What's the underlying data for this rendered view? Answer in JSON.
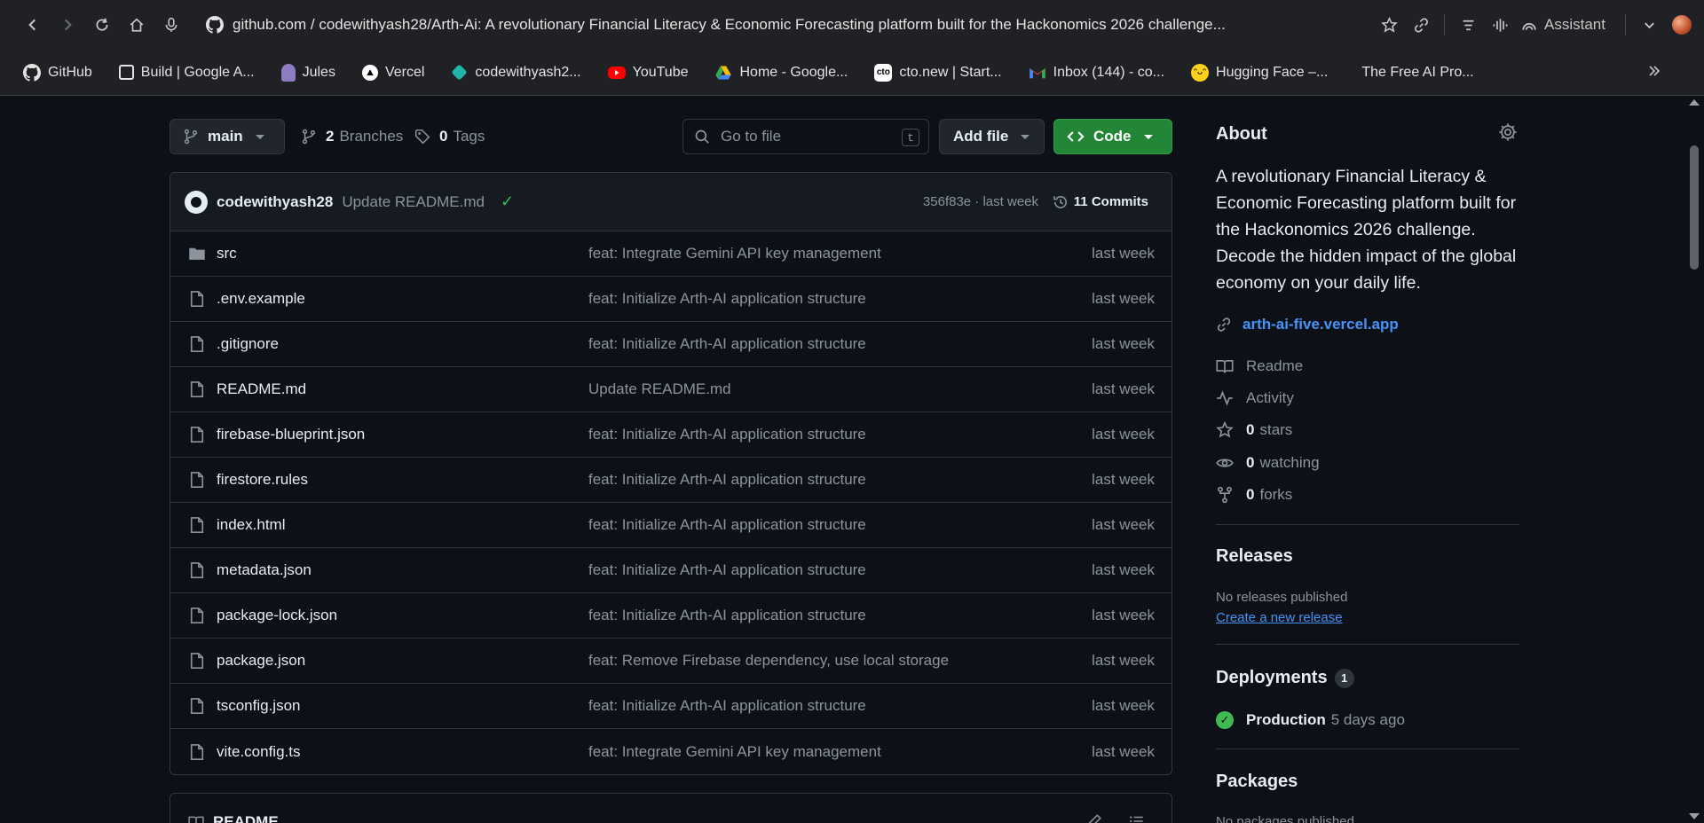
{
  "browser": {
    "url_host": "github.com",
    "url_path": " / codewithyash28/Arth-Ai: A revolutionary Financial Literacy & Economic Forecasting platform built for the Hackonomics 2026 challenge...",
    "assistant_label": "Assistant"
  },
  "bookmarks": [
    {
      "label": "GitHub",
      "icon": "github-icon"
    },
    {
      "label": "Build | Google A...",
      "icon": "google-ai-studio-icon"
    },
    {
      "label": "Jules",
      "icon": "jules-icon"
    },
    {
      "label": "Vercel",
      "icon": "vercel-icon"
    },
    {
      "label": "codewithyash2...",
      "icon": "diamond-icon"
    },
    {
      "label": "YouTube",
      "icon": "youtube-icon"
    },
    {
      "label": "Home - Google...",
      "icon": "google-drive-icon"
    },
    {
      "label": "cto.new | Start...",
      "icon": "cto-icon"
    },
    {
      "label": "Inbox (144) - co...",
      "icon": "gmail-icon"
    },
    {
      "label": "Hugging Face –...",
      "icon": "hugging-face-icon"
    },
    {
      "label": "The Free AI Pro...",
      "icon": ""
    }
  ],
  "repo_bar": {
    "branch": "main",
    "branches_count": "2",
    "branches_label": "Branches",
    "tags_count": "0",
    "tags_label": "Tags",
    "goto_placeholder": "Go to file",
    "goto_shortcut": "t",
    "add_file_label": "Add file",
    "code_label": "Code"
  },
  "latest_commit": {
    "author": "codewithyash28",
    "message": "Update README.md",
    "sha_time": "356f83e · last week",
    "commits_label": "11 Commits"
  },
  "files": [
    {
      "name": "src",
      "type": "folder",
      "message": "feat: Integrate Gemini API key management",
      "date": "last week"
    },
    {
      "name": ".env.example",
      "type": "file",
      "message": "feat: Initialize Arth-AI application structure",
      "date": "last week"
    },
    {
      "name": ".gitignore",
      "type": "file",
      "message": "feat: Initialize Arth-AI application structure",
      "date": "last week"
    },
    {
      "name": "README.md",
      "type": "file",
      "message": "Update README.md",
      "date": "last week"
    },
    {
      "name": "firebase-blueprint.json",
      "type": "file",
      "message": "feat: Initialize Arth-AI application structure",
      "date": "last week"
    },
    {
      "name": "firestore.rules",
      "type": "file",
      "message": "feat: Initialize Arth-AI application structure",
      "date": "last week"
    },
    {
      "name": "index.html",
      "type": "file",
      "message": "feat: Initialize Arth-AI application structure",
      "date": "last week"
    },
    {
      "name": "metadata.json",
      "type": "file",
      "message": "feat: Initialize Arth-AI application structure",
      "date": "last week"
    },
    {
      "name": "package-lock.json",
      "type": "file",
      "message": "feat: Initialize Arth-AI application structure",
      "date": "last week"
    },
    {
      "name": "package.json",
      "type": "file",
      "message": "feat: Remove Firebase dependency, use local storage",
      "date": "last week"
    },
    {
      "name": "tsconfig.json",
      "type": "file",
      "message": "feat: Initialize Arth-AI application structure",
      "date": "last week"
    },
    {
      "name": "vite.config.ts",
      "type": "file",
      "message": "feat: Integrate Gemini API key management",
      "date": "last week"
    }
  ],
  "readme_box": {
    "label": "README"
  },
  "about": {
    "heading": "About",
    "description": "A revolutionary Financial Literacy & Economic Forecasting platform built for the Hackonomics 2026 challenge. Decode the hidden impact of the global economy on your daily life.",
    "website": "arth-ai-five.vercel.app",
    "readme": "Readme",
    "activity": "Activity",
    "stars_count": "0",
    "stars_label": "stars",
    "watching_count": "0",
    "watching_label": "watching",
    "forks_count": "0",
    "forks_label": "forks"
  },
  "releases": {
    "heading": "Releases",
    "none_text": "No releases published",
    "create_link": "Create a new release"
  },
  "deployments": {
    "heading": "Deployments",
    "count": "1",
    "env": "Production",
    "when": "5 days ago"
  },
  "packages": {
    "heading": "Packages",
    "none_text": "No packages published"
  },
  "colors": {
    "background": "#0d1117",
    "border": "#30363d",
    "link": "#4493f8",
    "code_button": "#238636",
    "success": "#3fb950"
  }
}
